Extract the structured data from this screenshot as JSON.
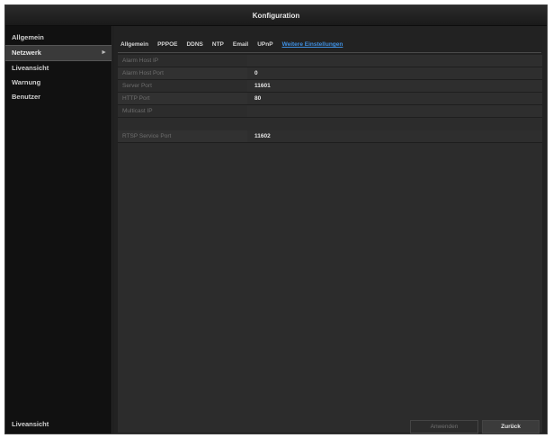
{
  "window": {
    "title": "Konfiguration"
  },
  "sidebar": {
    "items": [
      {
        "label": "Allgemein"
      },
      {
        "label": "Netzwerk",
        "arrow": "►"
      },
      {
        "label": "Liveansicht"
      },
      {
        "label": "Warnung"
      },
      {
        "label": "Benutzer"
      }
    ],
    "bottom_label": "Liveansicht"
  },
  "tabs": [
    {
      "label": "Allgemein"
    },
    {
      "label": "PPPOE"
    },
    {
      "label": "DDNS"
    },
    {
      "label": "NTP"
    },
    {
      "label": "Email"
    },
    {
      "label": "UPnP"
    },
    {
      "label": "Weitere Einstellungen"
    }
  ],
  "settings": [
    {
      "label": "Alarm Host IP",
      "value": ""
    },
    {
      "label": "Alarm Host Port",
      "value": "0"
    },
    {
      "label": "Server Port",
      "value": "11601"
    },
    {
      "label": "HTTP Port",
      "value": "80"
    },
    {
      "label": "Multicast IP",
      "value": ""
    },
    {
      "label": "RTSP Service Port",
      "value": "11602"
    }
  ],
  "buttons": {
    "apply": "Anwenden",
    "back": "Zurück"
  },
  "colors": {
    "accent_tab": "#3f8fe0",
    "background": "#222222"
  }
}
